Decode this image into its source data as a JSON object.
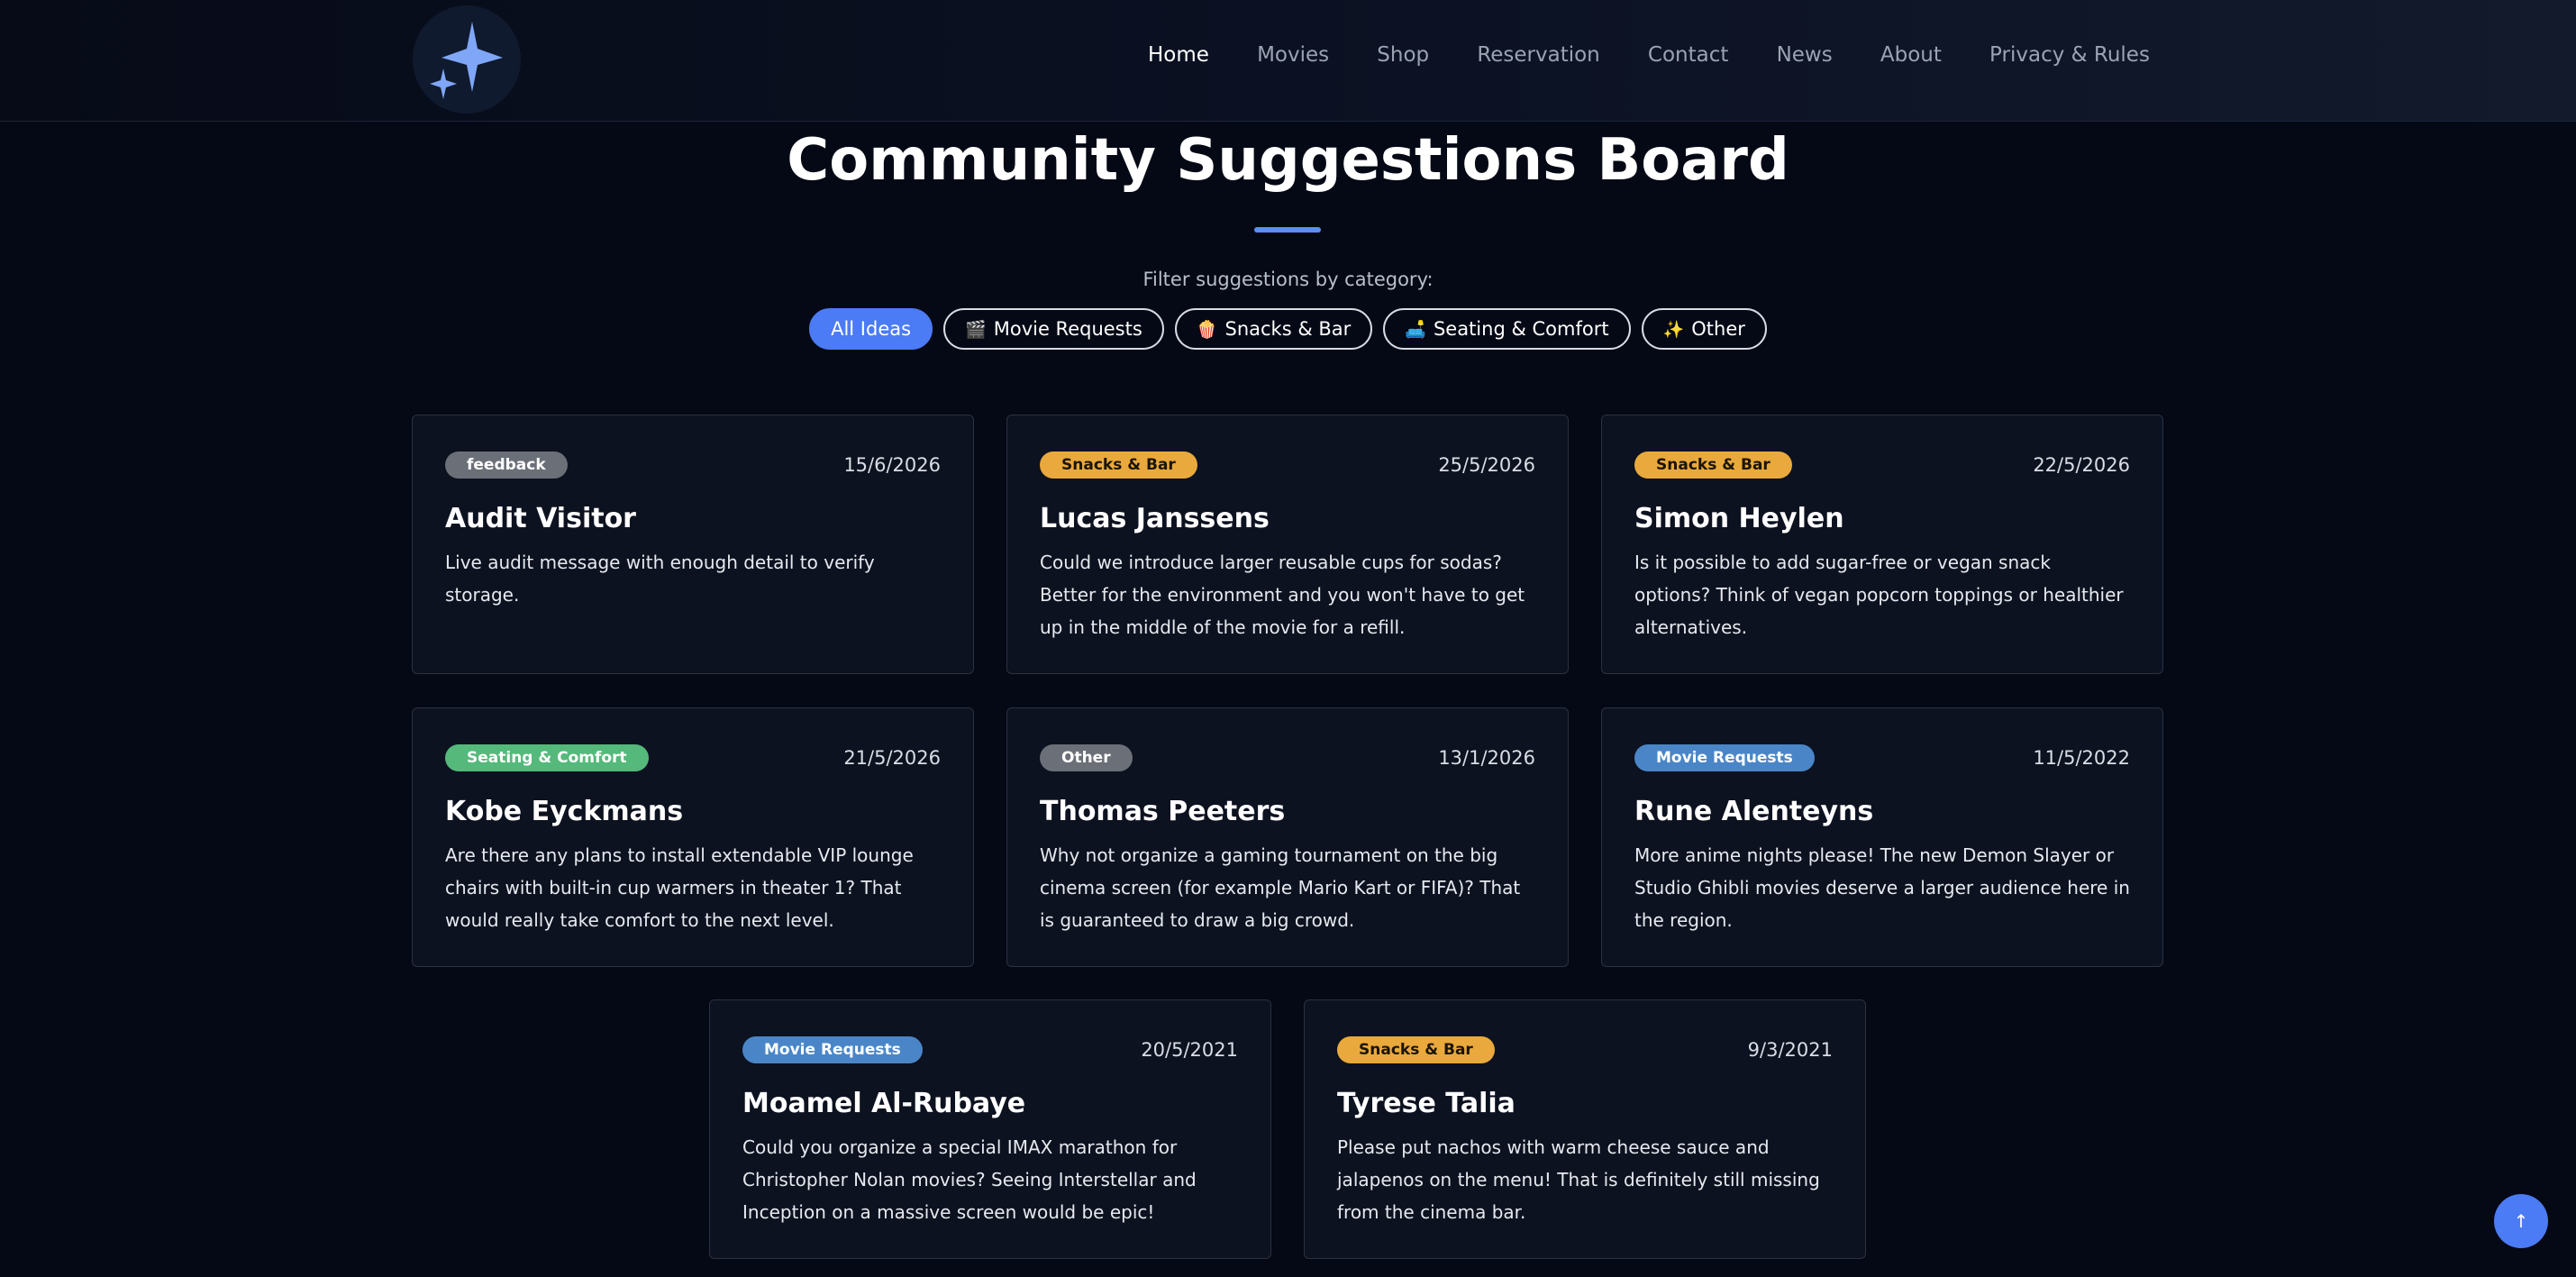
{
  "nav": {
    "items": [
      {
        "label": "Home"
      },
      {
        "label": "Movies"
      },
      {
        "label": "Shop"
      },
      {
        "label": "Reservation"
      },
      {
        "label": "Contact"
      },
      {
        "label": "News"
      },
      {
        "label": "About"
      },
      {
        "label": "Privacy & Rules"
      }
    ],
    "active": "Home"
  },
  "page": {
    "title": "Community Suggestions Board",
    "filter_label": "Filter suggestions by category:"
  },
  "filters": [
    {
      "label": "All Ideas",
      "icon": "",
      "active": true
    },
    {
      "label": "Movie Requests",
      "icon": "🎬",
      "icon_name": "clapperboard-icon"
    },
    {
      "label": "Snacks & Bar",
      "icon": "🍿",
      "icon_name": "popcorn-icon"
    },
    {
      "label": "Seating & Comfort",
      "icon": "🛋️",
      "icon_name": "couch-icon"
    },
    {
      "label": "Other",
      "icon": "✨",
      "icon_name": "sparkles-icon"
    }
  ],
  "cards": [
    {
      "category": "feedback",
      "date": "15/6/2026",
      "name": "Audit Visitor",
      "message": "Live audit message with enough detail to verify storage."
    },
    {
      "category": "Snacks & Bar",
      "date": "25/5/2026",
      "name": "Lucas Janssens",
      "message": "Could we introduce larger reusable cups for sodas? Better for the environment and you won't have to get up in the middle of the movie for a refill."
    },
    {
      "category": "Snacks & Bar",
      "date": "22/5/2026",
      "name": "Simon Heylen",
      "message": "Is it possible to add sugar-free or vegan snack options? Think of vegan popcorn toppings or healthier alternatives."
    },
    {
      "category": "Seating & Comfort",
      "date": "21/5/2026",
      "name": "Kobe Eyckmans",
      "message": "Are there any plans to install extendable VIP lounge chairs with built-in cup warmers in theater 1? That would really take comfort to the next level."
    },
    {
      "category": "Other",
      "date": "13/1/2026",
      "name": "Thomas Peeters",
      "message": "Why not organize a gaming tournament on the big cinema screen (for example Mario Kart or FIFA)? That is guaranteed to draw a big crowd."
    },
    {
      "category": "Movie Requests",
      "date": "11/5/2022",
      "name": "Rune Alenteyns",
      "message": "More anime nights please! The new Demon Slayer or Studio Ghibli movies deserve a larger audience here in the region."
    },
    {
      "category": "Movie Requests",
      "date": "20/5/2021",
      "name": "Moamel Al-Rubaye",
      "message": "Could you organize a special IMAX marathon for Christopher Nolan movies? Seeing Interstellar and Inception on a massive screen would be epic!"
    },
    {
      "category": "Snacks & Bar",
      "date": "9/3/2021",
      "name": "Tyrese Talia",
      "message": "Please put nachos with warm cheese sauce and jalapenos on the menu! That is definitely still missing from the cinema bar."
    }
  ],
  "scroll_top": {
    "icon": "↑",
    "icon_name": "arrow-up-icon"
  },
  "colors": {
    "accent": "#4b7bf5",
    "background": "#050915",
    "card": "#0d1220",
    "badge_snacks": "#e9a93c",
    "badge_seating": "#54b97a",
    "badge_movie": "#4a86c7",
    "badge_neutral": "#6b6f78"
  }
}
